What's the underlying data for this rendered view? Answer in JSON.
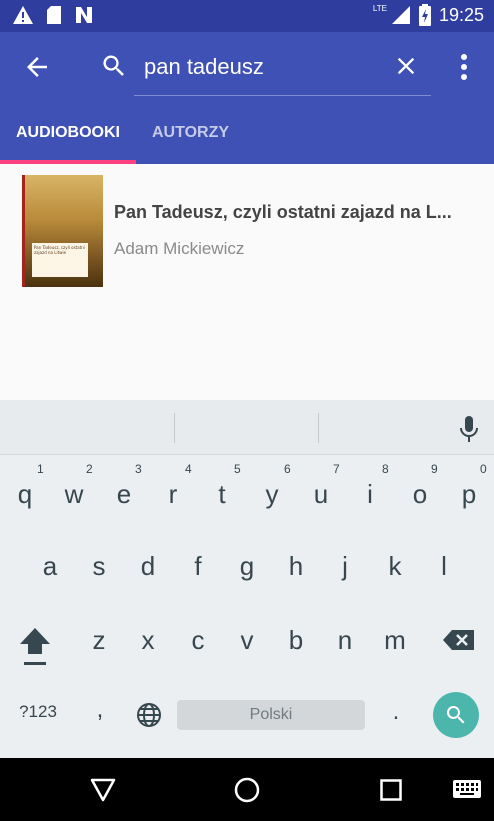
{
  "status_bar": {
    "time": "19:25",
    "network": "LTE",
    "icons": [
      "warning-icon",
      "sd-card-icon",
      "n-icon",
      "signal-icon",
      "battery-icon"
    ]
  },
  "search": {
    "query": "pan tadeusz"
  },
  "tabs": [
    {
      "label": "AUDIOBOOKI",
      "selected": true
    },
    {
      "label": "AUTORZY",
      "selected": false
    }
  ],
  "results": [
    {
      "title": "Pan Tadeusz, czyli ostatni zajazd na L...",
      "author": "Adam Mickiewicz",
      "cover_text": "Pan Tadeusz, czyli ostatni zajazd na Litwie"
    }
  ],
  "keyboard": {
    "row1": [
      "q",
      "w",
      "e",
      "r",
      "t",
      "y",
      "u",
      "i",
      "o",
      "p"
    ],
    "row1_hints": [
      "1",
      "2",
      "3",
      "4",
      "5",
      "6",
      "7",
      "8",
      "9",
      "0"
    ],
    "row2": [
      "a",
      "s",
      "d",
      "f",
      "g",
      "h",
      "j",
      "k",
      "l"
    ],
    "row3": [
      "z",
      "x",
      "c",
      "v",
      "b",
      "n",
      "m"
    ],
    "symbols_label": "?123",
    "comma": ",",
    "space_label": "Polski",
    "period": "."
  },
  "colors": {
    "primary": "#3f51b5",
    "status": "#2e3d9e",
    "accent": "#ff4081",
    "search_key": "#4db6ac"
  }
}
